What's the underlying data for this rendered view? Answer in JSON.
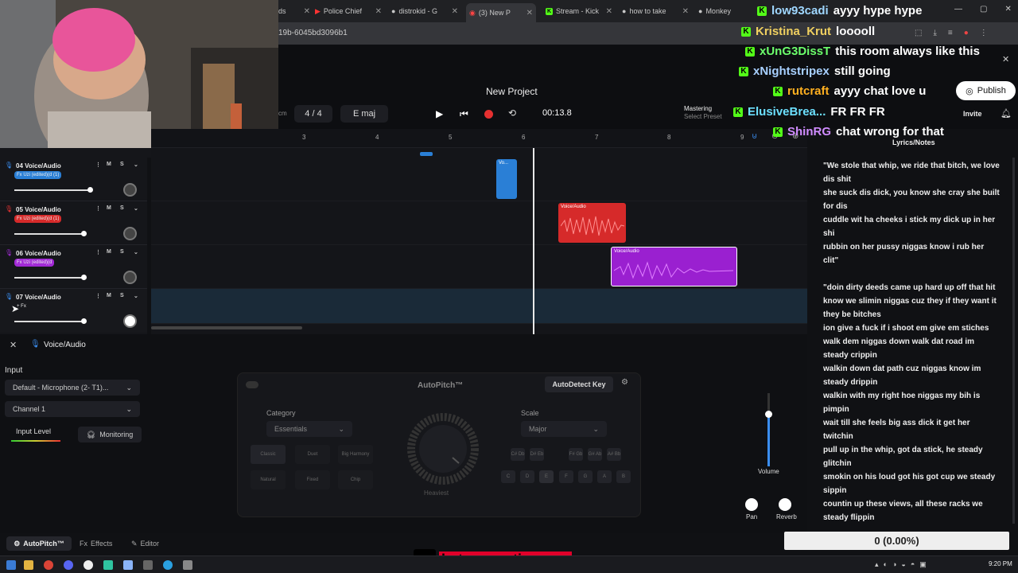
{
  "browser": {
    "tabs": [
      {
        "label": "ds",
        "icon": "tab-icon"
      },
      {
        "label": "Police Chief",
        "icon": "youtube-icon"
      },
      {
        "label": "distrokid - G",
        "icon": "google-icon"
      },
      {
        "label": "(3) New P",
        "icon": "record-icon"
      },
      {
        "label": "Stream - Kick",
        "icon": "kick-icon"
      },
      {
        "label": "how to take",
        "icon": "google-icon"
      },
      {
        "label": "Monkey",
        "icon": "tab-icon"
      }
    ],
    "url": "19b-6045bd3096b1"
  },
  "header": {
    "project_name": "New Project",
    "time_sig": "4 / 4",
    "key": "E maj",
    "time": "00:13.8",
    "mastering": "Mastering",
    "mastering_sub": "Select Preset",
    "publish": "Publish",
    "invite": "Invite",
    "cm_label": "cm"
  },
  "ruler": {
    "marks": [
      "3",
      "4",
      "5",
      "6",
      "7",
      "8",
      "9"
    ]
  },
  "tracks": [
    {
      "num": "04",
      "name": "Voice/Audio",
      "fx": "Fx Uzi (edited)(d (1)",
      "fx_color": "#2a7fd6",
      "mute": "M",
      "solo": "S",
      "vol": 0.96
    },
    {
      "num": "05",
      "name": "Voice/Audio",
      "fx": "Fx Uzi (edited)(d (1)",
      "fx_color": "#d62a2a",
      "mute": "M",
      "solo": "S",
      "vol": 0.88
    },
    {
      "num": "06",
      "name": "Voice/Audio",
      "fx": "Fx Uzi (edited)(d",
      "fx_color": "#a22ad6",
      "mute": "M",
      "solo": "S",
      "vol": 0.88
    },
    {
      "num": "07",
      "name": "Voice/Audio",
      "fx": "+ Fx",
      "fx_color": "transparent",
      "mute": "M",
      "solo": "S",
      "vol": 0.88
    }
  ],
  "clips": [
    {
      "label": "Vo...",
      "color": "#2a7fd6"
    },
    {
      "label": "Voice/Audio",
      "color": "#d62a2a"
    },
    {
      "label": "Voice/Audio",
      "color": "#9a20d0"
    }
  ],
  "lower": {
    "track_title": "Voice/Audio",
    "input_label": "Input",
    "input_device": "Default - Microphone (2- T1)...",
    "channel": "Channel 1",
    "input_level": "Input Level",
    "monitoring": "Monitoring",
    "autopitch_title": "AutoPitch™",
    "autodetect": "AutoDetect Key",
    "category_label": "Category",
    "category_value": "Essentials",
    "scale_label": "Scale",
    "scale_value": "Major",
    "knob_label": "Heaviest",
    "presets": [
      "Classic",
      "Duet",
      "Big Harmony",
      "Natural",
      "Fixed",
      "Chip"
    ],
    "key_grid_top": [
      "C#\nDb",
      "D#\nEb",
      "F#\nGb",
      "G#\nAb",
      "A#\nBb"
    ],
    "key_grid_bottom": [
      "C",
      "D",
      "E",
      "F",
      "G",
      "A",
      "B"
    ],
    "volume": "Volume",
    "pan": "Pan",
    "reverb": "Reverb"
  },
  "bottom_nav": {
    "autopitch": "AutoPitch™",
    "effects": "Effects",
    "editor": "Editor"
  },
  "lyrics": {
    "title": "Lyrics/Notes",
    "text": "\"We stole that whip, we ride that bitch, we love dis shit\nshe suck dis dick, you know she cray she built for dis\ncuddle wit ha cheeks i stick my dick up in her shi\nrubbin on her pussy niggas know i rub her clit\"\n\n\"doin dirty deeds came up hard up off that hit\nknow we slimin niggas cuz they if they want it they be bitches\nion give a fuck if i shoot em give em stiches\nwalk dem niggas down walk dat road im steady crippin\nwalkin down dat path cuz niggas know im steady drippin\nwalkin with my right hoe niggas my bih is pimpin\nwait till she feels big ass dick it get her twitchin\npull up in the whip, got da stick, he steady glitchin\nsmokin on his loud got his got cup we steady sippin\ncountin up these views, all these racks we steady flippin"
  },
  "chat": [
    {
      "user": "low93cadi",
      "msg": "ayyy hype hype",
      "color": "#9fd7ff"
    },
    {
      "user": "Kristina_Krut",
      "msg": "looooll",
      "color": "#f0d060"
    },
    {
      "user": "xUnG3DissT",
      "msg": "this room always like this",
      "color": "#6cff6c"
    },
    {
      "user": "xNightstripex",
      "msg": "still going",
      "color": "#a8d0ff"
    },
    {
      "user": "rutcraft",
      "msg": "ayyy chat love u",
      "color": "#ffb020"
    },
    {
      "user": "ElusiveBrea...",
      "msg": "FR FR FR",
      "color": "#6ce0ff"
    },
    {
      "user": "ShinRG",
      "msg": "chat wrong for that",
      "color": "#d08cff"
    }
  ],
  "counter": "0 (0.00%)",
  "tiktok_handle": "betyoucantignoree",
  "taskbar": {
    "time": "9:20 PM"
  }
}
